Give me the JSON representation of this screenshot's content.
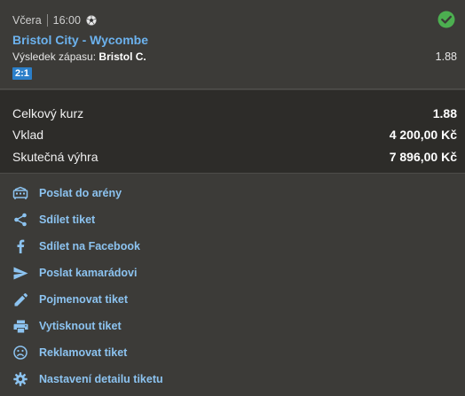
{
  "bet": {
    "day": "Včera",
    "time": "16:00",
    "sport_icon": "soccer-ball-icon",
    "status_icon": "check-circle-icon",
    "match": "Bristol City - Wycombe",
    "result_label": "Výsledek zápasu:",
    "result_pick": "Bristol C.",
    "odd": "1.88",
    "score": "2:1"
  },
  "summary": {
    "total_odds_label": "Celkový kurz",
    "total_odds_value": "1.88",
    "stake_label": "Vklad",
    "stake_value": "4 200,00 Kč",
    "win_label": "Skutečná výhra",
    "win_value": "7 896,00 Kč"
  },
  "actions": [
    {
      "label": "Poslat do arény",
      "icon": "arena-icon"
    },
    {
      "label": "Sdílet tiket",
      "icon": "share-icon"
    },
    {
      "label": "Sdílet na Facebook",
      "icon": "facebook-icon"
    },
    {
      "label": "Poslat kamarádovi",
      "icon": "send-icon"
    },
    {
      "label": "Pojmenovat tiket",
      "icon": "pencil-icon"
    },
    {
      "label": "Vytisknout tiket",
      "icon": "printer-icon"
    },
    {
      "label": "Reklamovat tiket",
      "icon": "sad-face-icon"
    },
    {
      "label": "Nastavení detailu tiketu",
      "icon": "gear-icon"
    }
  ],
  "colors": {
    "accent": "#8cc3f0",
    "link": "#6cb2ee",
    "success": "#4caf50",
    "score_badge": "#2b7fc9"
  }
}
